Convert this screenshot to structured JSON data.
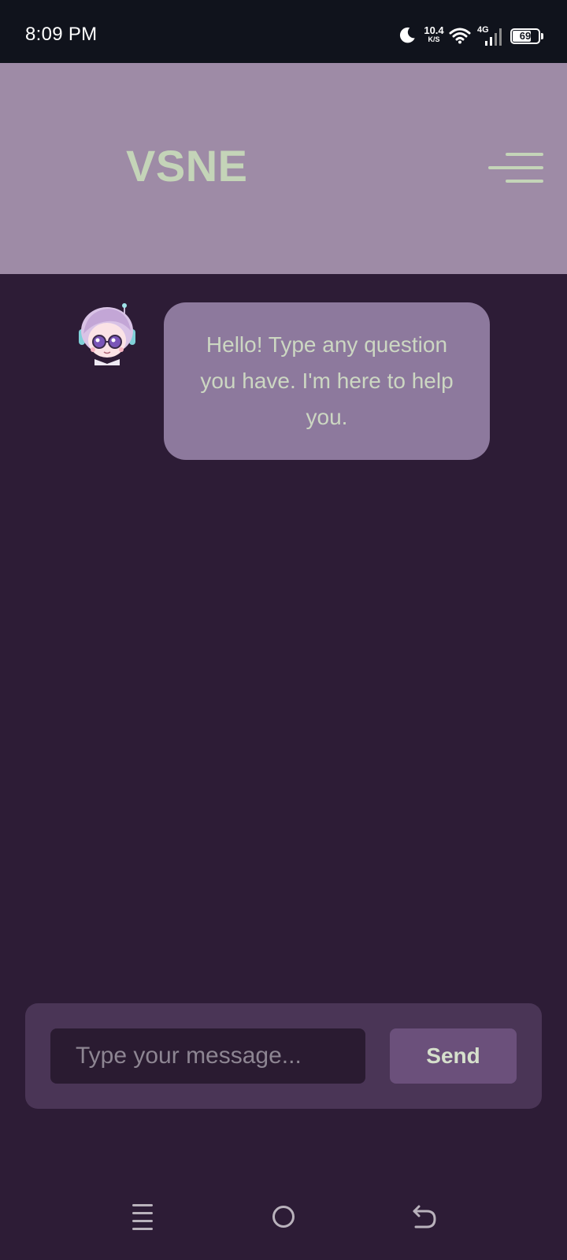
{
  "status_bar": {
    "time": "8:09 PM",
    "net_speed_value": "10.4",
    "net_speed_unit": "K/S",
    "network_type": "4G",
    "battery_level": "69",
    "icons": [
      "moon-icon",
      "wifi-icon",
      "signal-icon",
      "battery-icon"
    ]
  },
  "header": {
    "title": "VSNE",
    "menu_icon": "hamburger-menu-icon"
  },
  "chat": {
    "messages": [
      {
        "sender": "bot",
        "text": "Hello! Type any question you have. I'm here to help you."
      }
    ]
  },
  "composer": {
    "placeholder": "Type your message...",
    "value": "",
    "send_label": "Send"
  },
  "nav_bar": {
    "buttons": [
      "recent-apps-icon",
      "home-icon",
      "back-icon"
    ]
  },
  "colors": {
    "background": "#2d1c36",
    "header": "#9e8ba6",
    "title": "#c4d4b8",
    "bubble": "#8d799d",
    "composer": "#4a3556",
    "send_button": "#6b507b"
  }
}
